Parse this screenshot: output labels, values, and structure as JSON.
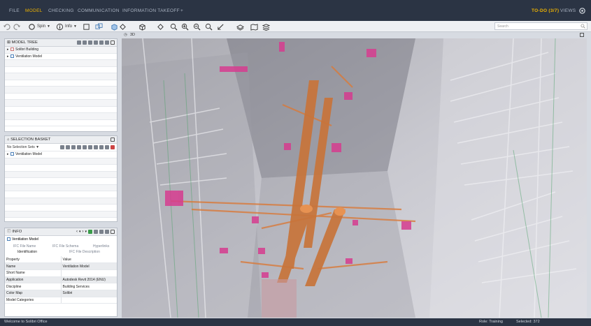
{
  "menu": {
    "items": [
      {
        "label": "FILE",
        "active": false
      },
      {
        "label": "MODEL",
        "active": true
      },
      {
        "label": "CHECKING",
        "active": false
      },
      {
        "label": "COMMUNICATION",
        "active": false
      },
      {
        "label": "INFORMATION TAKEOFF",
        "active": false
      },
      {
        "label": "+",
        "active": false
      }
    ],
    "todo": "TO-DO (3/7)",
    "views": "VIEWS",
    "accent": "#f0b400"
  },
  "toolbar": {
    "spin_label": "Spin",
    "info_label": "Info",
    "search_placeholder": "Search"
  },
  "model_tree": {
    "title": "MODEL TREE",
    "items": [
      "Solibri Building",
      "Ventilation Model"
    ]
  },
  "selection_basket": {
    "title": "SELECTION BASKET",
    "selection_sets": "No Selection Sets",
    "items": [
      "Ventilation Model"
    ]
  },
  "info": {
    "title": "INFO",
    "object": "Ventilation Model",
    "tabs_row1": [
      "IFC File Name",
      "IFC File Schema",
      "Hyperlinks"
    ],
    "tabs_row2": [
      "Identification",
      "IFC File Description"
    ],
    "columns": [
      "Property",
      "Value"
    ],
    "rows": [
      {
        "property": "Name",
        "value": "Ventilation Model"
      },
      {
        "property": "Short Name",
        "value": ""
      },
      {
        "property": "Application",
        "value": "Autodesk Revit 2014 (ENU)"
      },
      {
        "property": "Discipline",
        "value": "Building Services"
      },
      {
        "property": "Color Map",
        "value": "Solibri"
      },
      {
        "property": "Model Categories",
        "value": ""
      }
    ]
  },
  "viewport": {
    "title": "3D"
  },
  "status": {
    "welcome": "Welcome to Solibri Office",
    "role": "Role: Training",
    "selected": "Selected: 372"
  }
}
